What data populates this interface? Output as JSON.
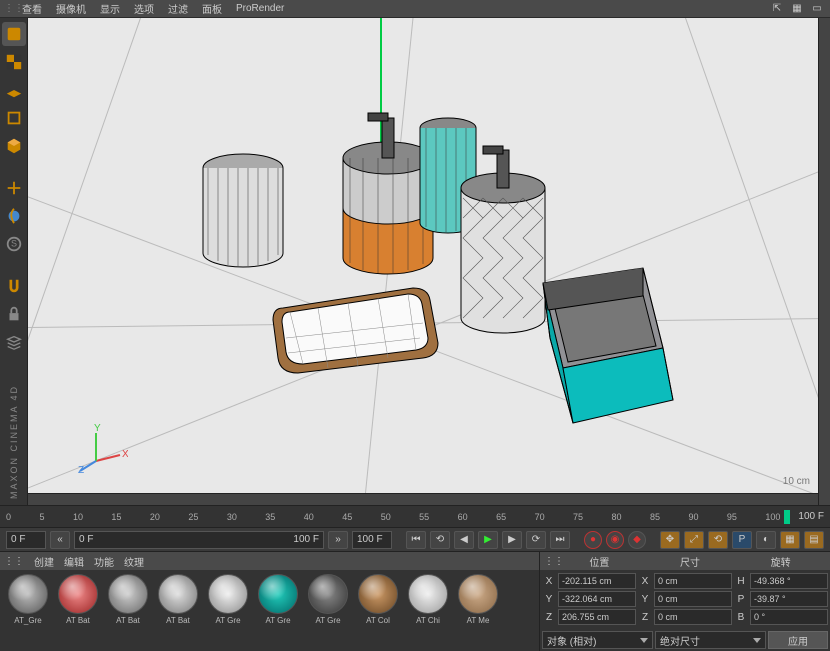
{
  "menubar": {
    "items": [
      "查看",
      "摄像机",
      "显示",
      "选项",
      "过滤",
      "面板",
      "ProRender"
    ]
  },
  "viewport": {
    "hud": "10 cm",
    "axes": {
      "x": "X",
      "y": "Y",
      "z": "Z"
    }
  },
  "timeline": {
    "ticks": [
      "0",
      "5",
      "10",
      "15",
      "20",
      "25",
      "30",
      "35",
      "40",
      "45",
      "50",
      "55",
      "60",
      "65",
      "70",
      "75",
      "80",
      "85",
      "90",
      "95",
      "100"
    ],
    "end_label": "100 F",
    "field_left": "0 F",
    "range_start": "0 F",
    "range_end": "100 F",
    "current": "100 F"
  },
  "materials": {
    "menu": [
      "创建",
      "编辑",
      "功能",
      "纹理"
    ],
    "items": [
      {
        "label": "AT_Gre",
        "c1": "#bbb",
        "c2": "#555"
      },
      {
        "label": "AT Bat",
        "c1": "#e88",
        "c2": "#922"
      },
      {
        "label": "AT Bat",
        "c1": "#ccc",
        "c2": "#666"
      },
      {
        "label": "AT Bat",
        "c1": "#ddd",
        "c2": "#777"
      },
      {
        "label": "AT Gre",
        "c1": "#eee",
        "c2": "#888"
      },
      {
        "label": "AT Gre",
        "c1": "#2cb",
        "c2": "#066"
      },
      {
        "label": "AT Gre",
        "c1": "#888",
        "c2": "#333"
      },
      {
        "label": "AT Col",
        "c1": "#c96",
        "c2": "#642"
      },
      {
        "label": "AT Chi",
        "c1": "#eee",
        "c2": "#999"
      },
      {
        "label": "AT Me",
        "c1": "#ca8",
        "c2": "#864"
      }
    ]
  },
  "coords": {
    "headers": {
      "pos": "位置",
      "size": "尺寸",
      "rot": "旋转"
    },
    "rows": [
      {
        "axis": "X",
        "pos": "-202.115 cm",
        "szAxis": "X",
        "size": "0 cm",
        "rotAxis": "H",
        "rot": "-49.368 °"
      },
      {
        "axis": "Y",
        "pos": "-322.064 cm",
        "szAxis": "Y",
        "size": "0 cm",
        "rotAxis": "P",
        "rot": "-39.87 °"
      },
      {
        "axis": "Z",
        "pos": "206.755 cm",
        "szAxis": "Z",
        "size": "0 cm",
        "rotAxis": "B",
        "rot": "0 °"
      }
    ],
    "dropdown1": "对象 (相对)",
    "dropdown2": "绝对尺寸",
    "apply": "应用"
  },
  "branding": "MAXON CINEMA 4D"
}
